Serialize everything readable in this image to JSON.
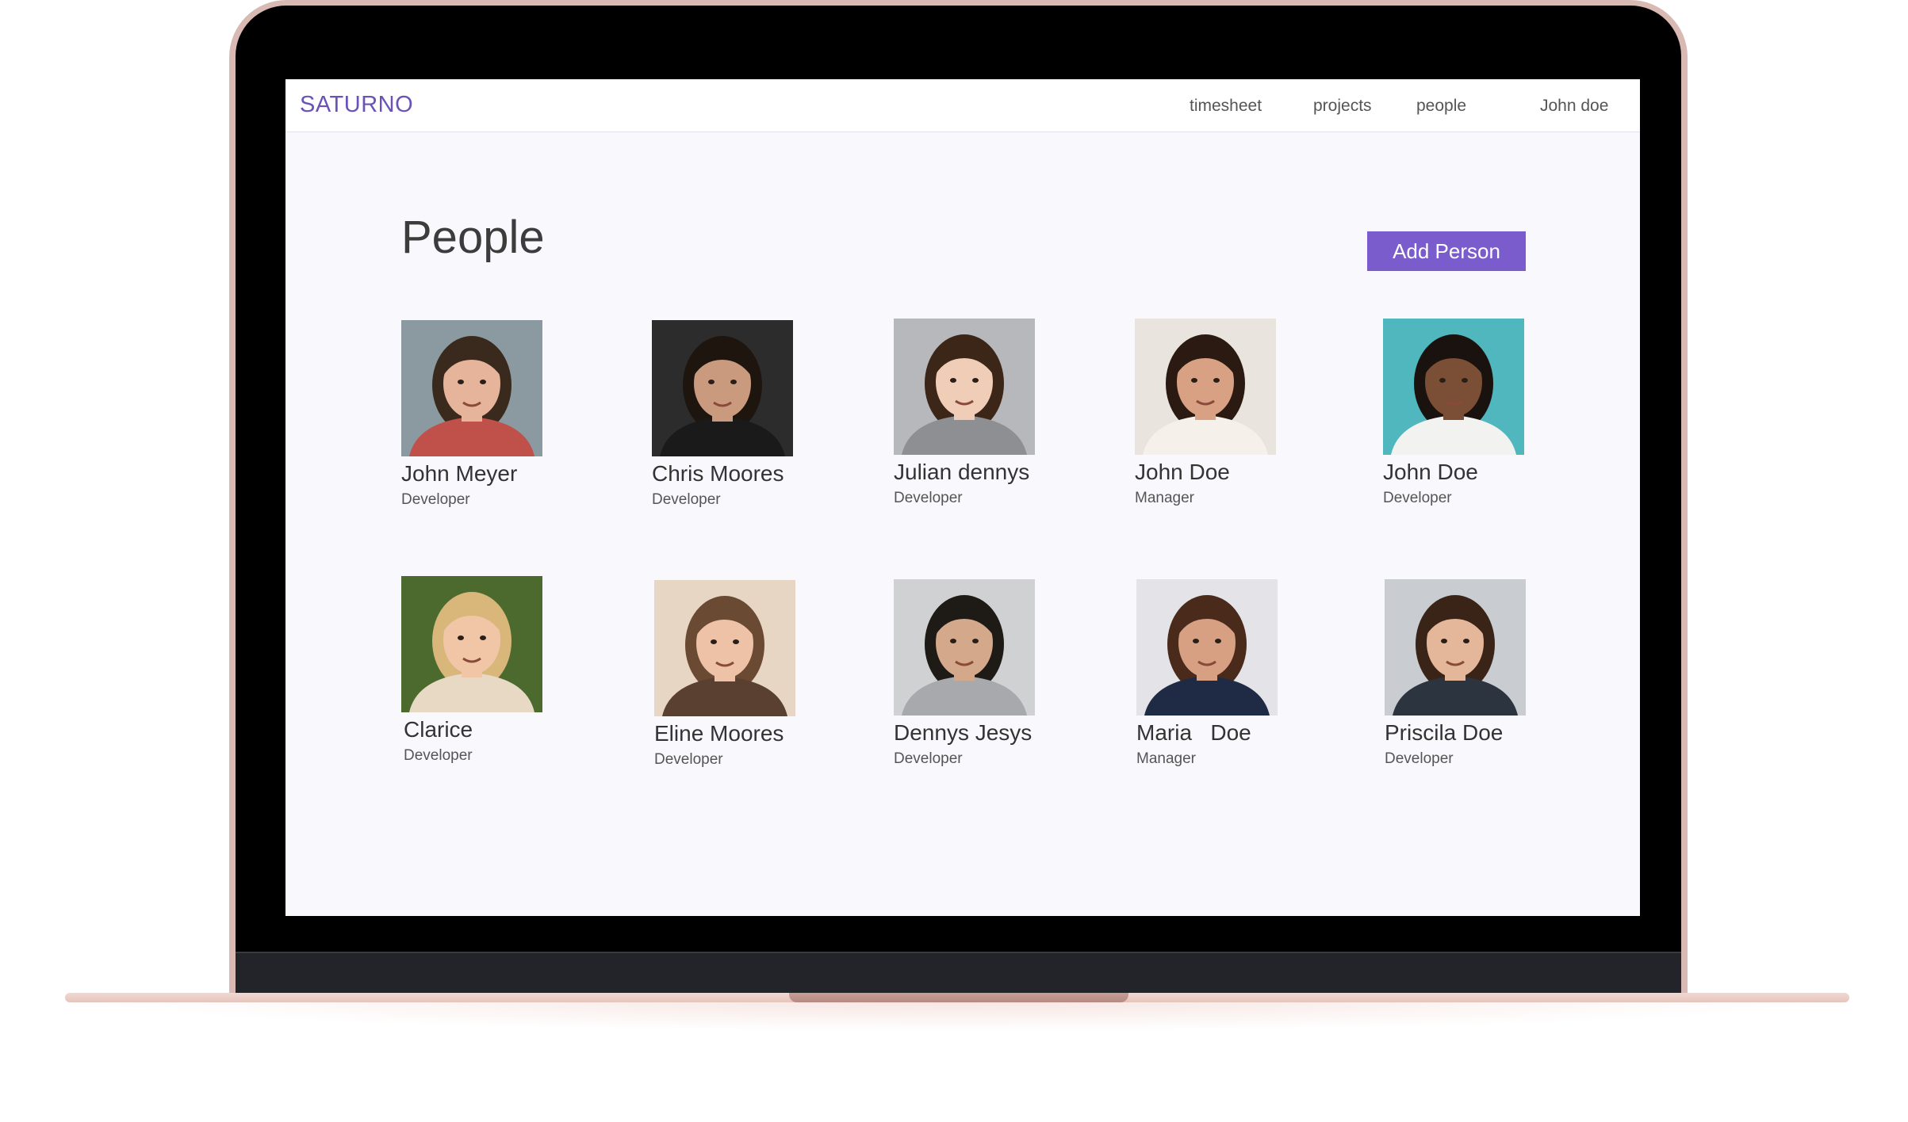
{
  "app": {
    "logo": "SATURNO",
    "nav": {
      "timesheet": "timesheet",
      "projects": "projects",
      "people": "people",
      "user": "John doe"
    }
  },
  "page": {
    "title": "People",
    "add_button": "Add  Person"
  },
  "people": [
    {
      "name": "John Meyer",
      "role": "Developer",
      "colors": {
        "bg": "#8a9aa0",
        "skin": "#e6b49a",
        "hair": "#3a2a1e",
        "shirt": "#c0504a"
      }
    },
    {
      "name": "Chris Moores",
      "role": "Developer",
      "colors": {
        "bg": "#2c2c2c",
        "skin": "#c99a7e",
        "hair": "#1e150f",
        "shirt": "#1a1a1a"
      }
    },
    {
      "name": "Julian dennys",
      "role": "Developer",
      "colors": {
        "bg": "#b6b8bb",
        "skin": "#f0cdb6",
        "hair": "#3b2618",
        "shirt": "#8e8f93"
      }
    },
    {
      "name": "John Doe",
      "role": "Manager",
      "colors": {
        "bg": "#e9e4de",
        "skin": "#d9a184",
        "hair": "#2a1a12",
        "shirt": "#f5f0ea"
      }
    },
    {
      "name": "John Doe",
      "role": "Developer",
      "colors": {
        "bg": "#4fb7bd",
        "skin": "#7b4e36",
        "hair": "#1a120e",
        "shirt": "#f2f2f0"
      }
    },
    {
      "name": "Clarice",
      "role": "Developer",
      "colors": {
        "bg": "#4c6a2e",
        "skin": "#f0c6a6",
        "hair": "#d9b77a",
        "shirt": "#e8d9c4"
      }
    },
    {
      "name": "Eline Moores",
      "role": "Developer",
      "colors": {
        "bg": "#e8d6c4",
        "skin": "#eec2a6",
        "hair": "#6a4a32",
        "shirt": "#5a4030"
      }
    },
    {
      "name": "Dennys Jesys",
      "role": "Developer",
      "colors": {
        "bg": "#cfd1d3",
        "skin": "#d4a88a",
        "hair": "#1e1a16",
        "shirt": "#a7a9ac"
      }
    },
    {
      "name": "Maria   Doe",
      "role": "Manager",
      "colors": {
        "bg": "#e4e4e8",
        "skin": "#d7a083",
        "hair": "#4a2a1a",
        "shirt": "#1f2a44"
      }
    },
    {
      "name": "Priscila Doe",
      "role": "Developer",
      "colors": {
        "bg": "#c9ccd0",
        "skin": "#e4b79a",
        "hair": "#3a2418",
        "shirt": "#2c3440"
      }
    }
  ]
}
